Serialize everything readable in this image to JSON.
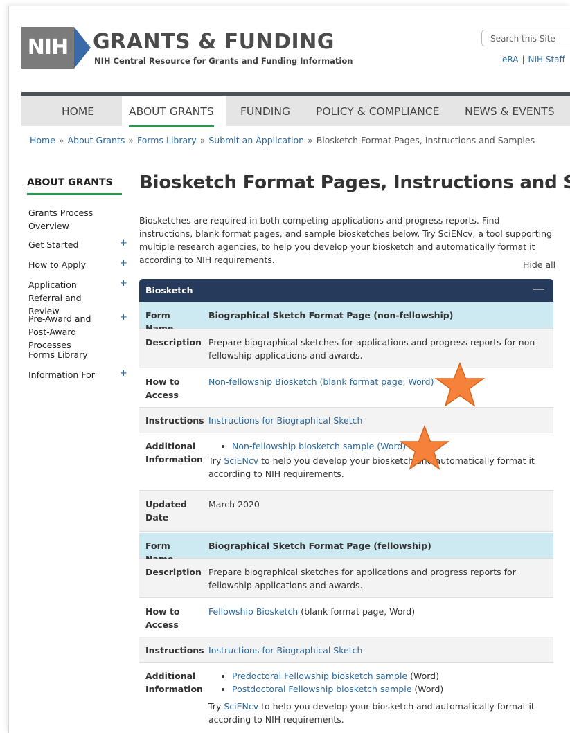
{
  "header": {
    "logo_text": "NIH",
    "title": "GRANTS & FUNDING",
    "subtitle": "NIH Central Resource for Grants and Funding Information",
    "search_placeholder": "Search this Site",
    "util_links": [
      "eRA",
      "NIH Staff"
    ]
  },
  "nav": {
    "items": [
      "HOME",
      "ABOUT GRANTS",
      "FUNDING",
      "POLICY & COMPLIANCE",
      "NEWS & EVENTS"
    ]
  },
  "breadcrumb": [
    "Home",
    "About Grants",
    "Forms Library",
    "Submit an Application",
    "Biosketch Format Pages, Instructions and Samples"
  ],
  "sidebar": {
    "title": "ABOUT GRANTS",
    "items": [
      {
        "label": "Grants Process Overview"
      },
      {
        "label": "Get Started",
        "plus": "+"
      },
      {
        "label": "How to Apply",
        "plus": "+"
      },
      {
        "label": "Application Referral and Review",
        "plus": "+"
      },
      {
        "label": "Pre-Award and Post-Award Processes",
        "plus": "+"
      },
      {
        "label": "Forms Library"
      },
      {
        "label": "Information For",
        "plus": "+"
      }
    ]
  },
  "main": {
    "title": "Biosketch Format Pages, Instructions and Samples",
    "intro": "Biosketches are required in both competing applications and progress reports. Find instructions, blank format pages, and sample biosketches below. Try SciENcv, a tool supporting multiple research agencies, to help you develop your biosketch and automatically format it according to NIH requirements.",
    "hide_all": "Hide all",
    "section": {
      "label": "Biosketch",
      "toggle": "—"
    },
    "labels": {
      "form_name": "Form Name",
      "description": "Description",
      "how_to_access": "How to Access",
      "instructions": "Instructions",
      "additional_information": "Additional Information",
      "updated_date": "Updated Date"
    },
    "form1": {
      "name": "Biographical Sketch Format Page (non-fellowship)",
      "description": "Prepare biographical sketches for applications and progress reports for non-fellowship applications and awards.",
      "access_link": "Non-fellowship Biosketch (blank format page, Word)",
      "instructions_link": "Instructions for Biographical Sketch",
      "bullet": "Non-fellowship biosketch sample (Word)",
      "try_pre": "Try ",
      "scincv": "SciENcv",
      "try_post": " to help you develop your biosketch and automatically format it according to NIH requirements.",
      "updated": "March 2020"
    },
    "form2": {
      "name": "Biographical Sketch Format Page (fellowship)",
      "description": "Prepare biographical sketches for applications and progress reports  for fellowship applications and awards.",
      "access_link": "Fellowship Biosketch",
      "access_rest": " (blank format page, Word)",
      "instructions_link": "Instructions for Biographical Sketch",
      "bullet1_link": "Predoctoral Fellowship biosketch sample",
      "bullet1_rest": " (Word)",
      "bullet2_link": "Postdoctoral Fellowship biosketch sample",
      "bullet2_rest": " (Word)",
      "try_pre": "Try ",
      "scincv": "SciENcv",
      "try_post": " to help you develop your biosketch and automatically format it according to NIH requirements."
    }
  },
  "colors": {
    "accent_green": "#2b9a51",
    "section_navy": "#263a5c",
    "header_row": "#cde9f1",
    "link_blue": "#2c6aa0",
    "star_orange": "#f5813a"
  }
}
